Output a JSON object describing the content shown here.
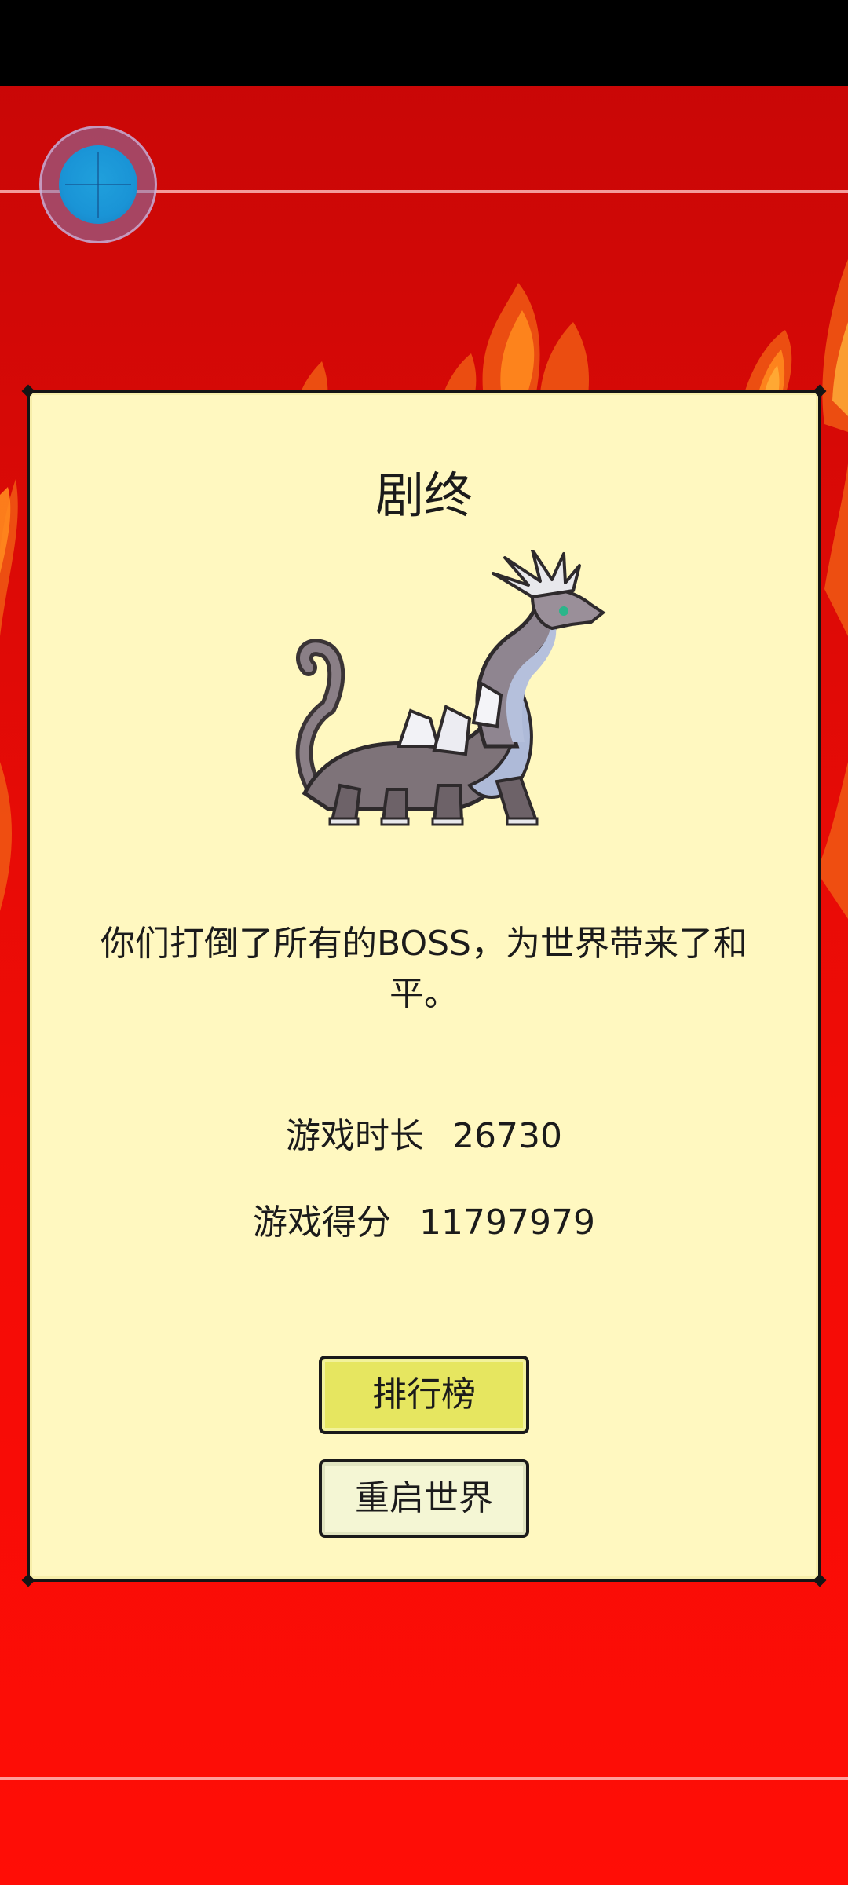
{
  "dialog": {
    "title": "剧终",
    "message": "你们打倒了所有的BOSS，为世界带来了和平。",
    "stats": {
      "play_time_label": "游戏时长",
      "play_time_value": "26730",
      "score_label": "游戏得分",
      "score_value": "11797979"
    },
    "buttons": {
      "leaderboard_label": "排行榜",
      "restart_label": "重启世界"
    },
    "illustration": "dragon-boss-sprite"
  },
  "hud": {
    "joystick_icon": "virtual-joystick-icon"
  },
  "colors": {
    "background": "#e00a06",
    "panel": "#fff8c0",
    "leaderboard_button": "#e6e660",
    "restart_button": "#f4f6d4",
    "joystick": "#1a94d6"
  }
}
